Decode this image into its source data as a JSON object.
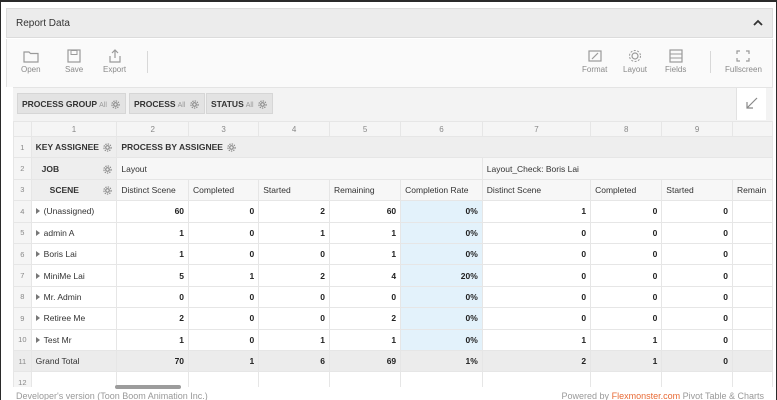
{
  "panel": {
    "title": "Report Data"
  },
  "toolbar": {
    "open": "Open",
    "save": "Save",
    "export": "Export",
    "format": "Format",
    "layout": "Layout",
    "fields": "Fields",
    "fullscreen": "Fullscreen"
  },
  "filters": [
    {
      "label": "PROCESS GROUP",
      "value": "All"
    },
    {
      "label": "PROCESS",
      "value": "All"
    },
    {
      "label": "STATUS",
      "value": "All"
    }
  ],
  "grid": {
    "col_numbers": [
      "1",
      "2",
      "3",
      "4",
      "5",
      "6",
      "7",
      "8",
      "9"
    ],
    "row_numbers": [
      "1",
      "2",
      "3",
      "4",
      "5",
      "6",
      "7",
      "8",
      "9",
      "10",
      "11",
      "12"
    ],
    "rows_header": "KEY ASSIGNEE",
    "cols_header": "PROCESS BY ASSIGNEE",
    "job_label": "JOB",
    "scene_label": "SCENE",
    "job_values": [
      "Layout",
      "Layout_Check: Boris Lai"
    ],
    "measures": [
      "Distinct Scene",
      "Completed",
      "Started",
      "Remaining",
      "Completion Rate",
      "Distinct Scene",
      "Completed",
      "Started",
      "Remain"
    ],
    "rows": [
      {
        "label": "(Unassigned)",
        "values": [
          "60",
          "0",
          "2",
          "60",
          "0%",
          "1",
          "0",
          "0",
          ""
        ]
      },
      {
        "label": "admin A",
        "values": [
          "1",
          "0",
          "1",
          "1",
          "0%",
          "0",
          "0",
          "0",
          ""
        ]
      },
      {
        "label": "Boris Lai",
        "values": [
          "1",
          "0",
          "0",
          "1",
          "0%",
          "0",
          "0",
          "0",
          ""
        ]
      },
      {
        "label": "MiniMe Lai",
        "values": [
          "5",
          "1",
          "2",
          "4",
          "20%",
          "0",
          "0",
          "0",
          ""
        ]
      },
      {
        "label": "Mr. Admin",
        "values": [
          "0",
          "0",
          "0",
          "0",
          "0%",
          "0",
          "0",
          "0",
          ""
        ]
      },
      {
        "label": "Retiree Me",
        "values": [
          "2",
          "0",
          "0",
          "2",
          "0%",
          "0",
          "0",
          "0",
          ""
        ]
      },
      {
        "label": "Test Mr",
        "values": [
          "1",
          "0",
          "1",
          "1",
          "0%",
          "1",
          "1",
          "0",
          ""
        ]
      }
    ],
    "total": {
      "label": "Grand Total",
      "values": [
        "70",
        "1",
        "6",
        "69",
        "1%",
        "2",
        "1",
        "0",
        ""
      ]
    }
  },
  "footer": {
    "left": "Developer's version (Toon Boom Animation Inc.)",
    "powered": "Powered by",
    "brand": "Flexmonster.com",
    "suffix": "Pivot Table & Charts"
  },
  "colors": {
    "accent": "#e86a35",
    "rate_bg": "#e3f2fb"
  }
}
